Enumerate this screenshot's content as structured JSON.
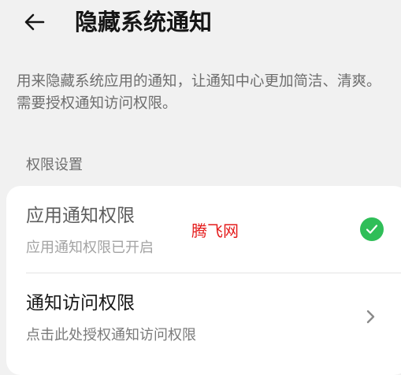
{
  "header": {
    "back_icon": "arrow-left-icon",
    "title": "隐藏系统通知"
  },
  "description": "用来隐藏系统应用的通知，让通知中心更加简洁、清爽。需要授权通知访问权限。",
  "section": {
    "label": "权限设置"
  },
  "permissions": [
    {
      "title": "应用通知权限",
      "subtitle": "应用通知权限已开启",
      "status": "enabled",
      "icon": "check-circle-icon",
      "icon_color": "#2fbe58"
    },
    {
      "title": "通知访问权限",
      "subtitle": "点击此处授权通知访问权限",
      "status": "not-granted",
      "icon": "chevron-right-icon"
    }
  ],
  "watermark": "腾飞网"
}
